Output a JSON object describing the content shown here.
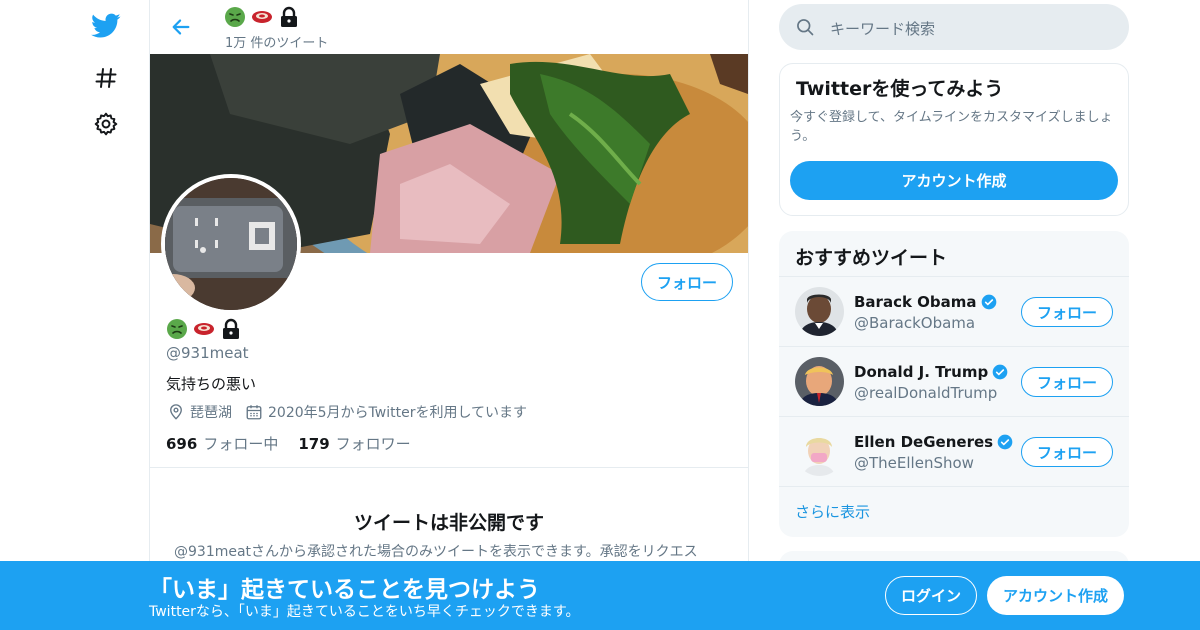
{
  "nav": {
    "icons": [
      "twitter-bird-icon",
      "hashtag-icon",
      "gear-icon"
    ]
  },
  "header": {
    "tweet_count": "1万 件のツイート"
  },
  "profile": {
    "handle": "@931meat",
    "bio": "気持ちの悪い",
    "location": "琵琶湖",
    "joined": "2020年5月からTwitterを利用しています",
    "following_count": "696",
    "following_label": "フォロー中",
    "followers_count": "179",
    "followers_label": "フォロワー",
    "follow_button": "フォロー",
    "private_title": "ツイートは非公開です",
    "private_desc": "@931meatさんから承認された場合のみツイートを表示できます。承認をリクエス"
  },
  "search": {
    "placeholder": "キーワード検索"
  },
  "signup_card": {
    "title": "Twitterを使ってみよう",
    "description": "今すぐ登録して、タイムラインをカスタマイズしましょう。",
    "button": "アカウント作成"
  },
  "who_to_follow": {
    "title": "おすすめツイート",
    "users": [
      {
        "name": "Barack Obama",
        "handle": "@BarackObama",
        "button": "フォロー"
      },
      {
        "name": "Donald J. Trump",
        "handle": "@realDonaldTrump",
        "button": "フォロー"
      },
      {
        "name": "Ellen DeGeneres",
        "handle": "@TheEllenShow",
        "button": "フォロー"
      }
    ],
    "show_more": "さらに表示"
  },
  "bottom_bar": {
    "title": "「いま」起きていることを見つけよう",
    "subtitle": "Twitterなら、「いま」起きていることをいち早くチェックできます。",
    "login": "ログイン",
    "signup": "アカウント作成"
  },
  "colors": {
    "accent": "#1da1f2",
    "text": "#14171a",
    "secondary": "#657786"
  }
}
